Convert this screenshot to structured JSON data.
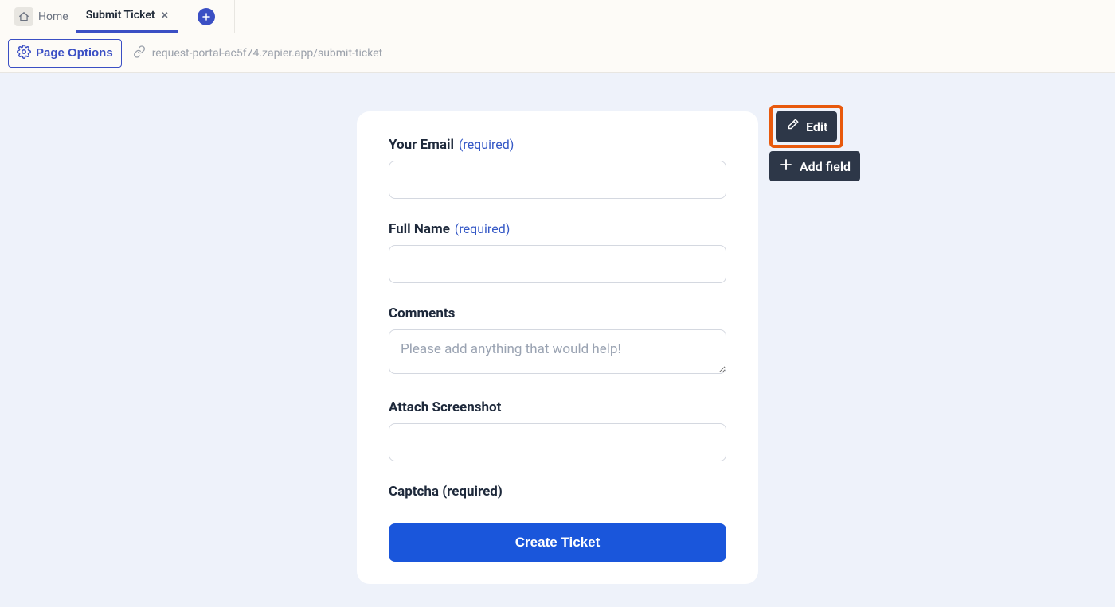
{
  "tabs": {
    "home_label": "Home",
    "active_label": "Submit Ticket"
  },
  "toolbar": {
    "page_options_label": "Page Options",
    "url": "request-portal-ac5f74.zapier.app/submit-ticket"
  },
  "form": {
    "fields": [
      {
        "label": "Your Email",
        "required_label": "(required)",
        "type": "text"
      },
      {
        "label": "Full Name",
        "required_label": "(required)",
        "type": "text"
      },
      {
        "label": "Comments",
        "required_label": "",
        "type": "textarea",
        "placeholder": "Please add anything that would help!"
      },
      {
        "label": "Attach Screenshot",
        "required_label": "",
        "type": "text"
      }
    ],
    "captcha_label": "Captcha (required)",
    "submit_label": "Create Ticket"
  },
  "float": {
    "edit_label": "Edit",
    "add_field_label": "Add field"
  },
  "colors": {
    "accent": "#3b4fc4",
    "submit": "#1a56db",
    "highlight_border": "#e8590c",
    "dark_btn": "#2d3748"
  }
}
